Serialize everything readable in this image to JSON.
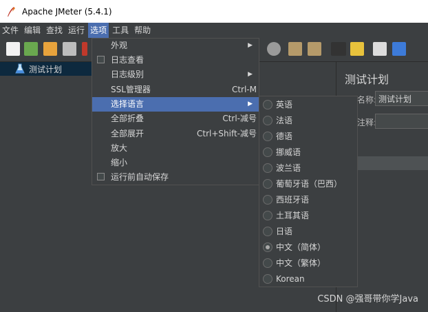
{
  "window": {
    "title": "Apache JMeter (5.4.1)"
  },
  "menubar": [
    "文件",
    "编辑",
    "查找",
    "运行",
    "选项",
    "工具",
    "帮助"
  ],
  "active_menu_index": 4,
  "toolbar_icons": [
    "new-icon",
    "templates-icon",
    "open-icon",
    "save-icon",
    "cut-icon",
    "stop-icon",
    "shutdown-icon",
    "clear-icon",
    "clear-all-icon",
    "search-icon",
    "reset-search-icon",
    "function-helper-icon",
    "help-icon"
  ],
  "tree": {
    "root": "测试计划"
  },
  "right_panel": {
    "title": "测试计划",
    "name_label": "名称:",
    "name_value": "测试计划",
    "comment_label": "注释:"
  },
  "options_menu": {
    "items": [
      {
        "label": "外观",
        "shortcut": "",
        "submenu": true
      },
      {
        "label": "日志查看",
        "shortcut": "",
        "checkbox": true
      },
      {
        "label": "日志级别",
        "shortcut": "",
        "submenu": true
      },
      {
        "label": "SSL管理器",
        "shortcut": "Ctrl-M"
      },
      {
        "label": "选择语言",
        "shortcut": "",
        "submenu": true,
        "highlighted": true
      },
      {
        "label": "全部折叠",
        "shortcut": "Ctrl-减号"
      },
      {
        "label": "全部展开",
        "shortcut": "Ctrl+Shift-减号"
      },
      {
        "label": "放大",
        "shortcut": ""
      },
      {
        "label": "缩小",
        "shortcut": ""
      },
      {
        "label": "运行前自动保存",
        "shortcut": "",
        "checkbox": true
      }
    ]
  },
  "language_submenu": {
    "options": [
      "英语",
      "法语",
      "德语",
      "挪威语",
      "波兰语",
      "葡萄牙语（巴西）",
      "西班牙语",
      "土耳其语",
      "日语",
      "中文（简体）",
      "中文（繁体）",
      "Korean"
    ],
    "selected": "中文（简体）"
  },
  "watermark": "CSDN @强哥带你学Java",
  "colors": {
    "background": "#3c3f41",
    "highlight": "#4b6eaf",
    "tree_selected": "#0d293e"
  }
}
